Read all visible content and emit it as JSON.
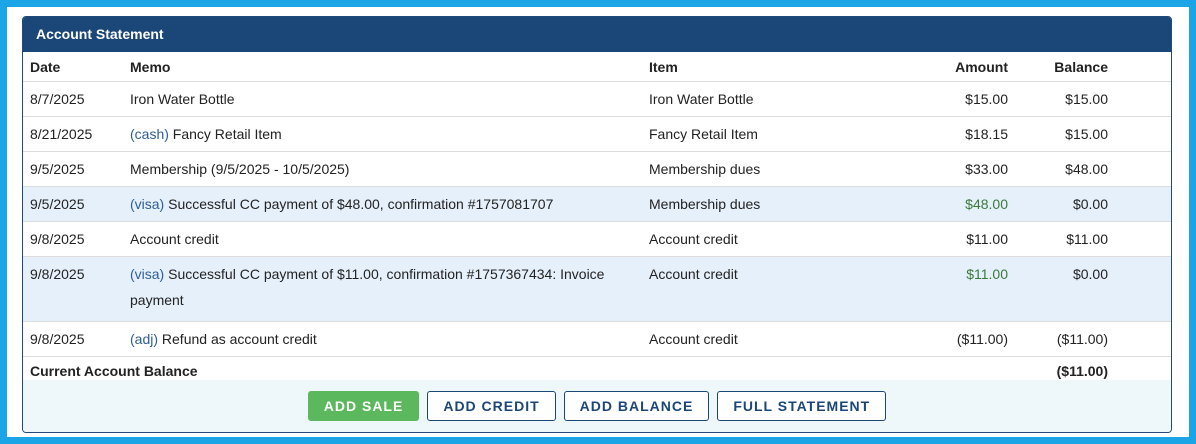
{
  "panel": {
    "title": "Account Statement"
  },
  "columns": {
    "date": "Date",
    "memo": "Memo",
    "item": "Item",
    "amount": "Amount",
    "balance": "Balance"
  },
  "rows": [
    {
      "date": "8/7/2025",
      "tag": "",
      "memo": "Iron Water Bottle",
      "item": "Iron Water Bottle",
      "amount": "$15.00",
      "balance": "$15.00"
    },
    {
      "date": "8/21/2025",
      "tag": "(cash)",
      "memo": " Fancy Retail Item",
      "item": "Fancy Retail Item",
      "amount": "$18.15",
      "balance": "$15.00"
    },
    {
      "date": "9/5/2025",
      "tag": "",
      "memo": "Membership (9/5/2025 - 10/5/2025)",
      "item": "Membership dues",
      "amount": "$33.00",
      "balance": "$48.00"
    },
    {
      "date": "9/5/2025",
      "tag": "(visa)",
      "memo": " Successful CC payment of $48.00, confirmation #1757081707",
      "item": "Membership dues",
      "amount": "$48.00",
      "balance": "$0.00"
    },
    {
      "date": "9/8/2025",
      "tag": "",
      "memo": "Account credit",
      "item": "Account credit",
      "amount": "$11.00",
      "balance": "$11.00"
    },
    {
      "date": "9/8/2025",
      "tag": "(visa)",
      "memo": " Successful CC payment of $11.00, confirmation #1757367434: Invoice payment",
      "item": "Account credit",
      "amount": "$11.00",
      "balance": "$0.00"
    },
    {
      "date": "9/8/2025",
      "tag": "(adj)",
      "memo": " Refund as account credit",
      "item": "Account credit",
      "amount": "($11.00)",
      "balance": "($11.00)"
    }
  ],
  "total": {
    "label": "Current Account Balance",
    "value": "($11.00)"
  },
  "buttons": {
    "add_sale": "ADD SALE",
    "add_credit": "ADD CREDIT",
    "add_balance": "ADD BALANCE",
    "full_statement": "FULL STATEMENT"
  },
  "colors": {
    "header": "#1b4678",
    "frame": "#1ba4e6",
    "highlight_row": "#e6f0fb",
    "payment_amount": "#3a7a3a",
    "primary_button": "#5cb85c"
  }
}
